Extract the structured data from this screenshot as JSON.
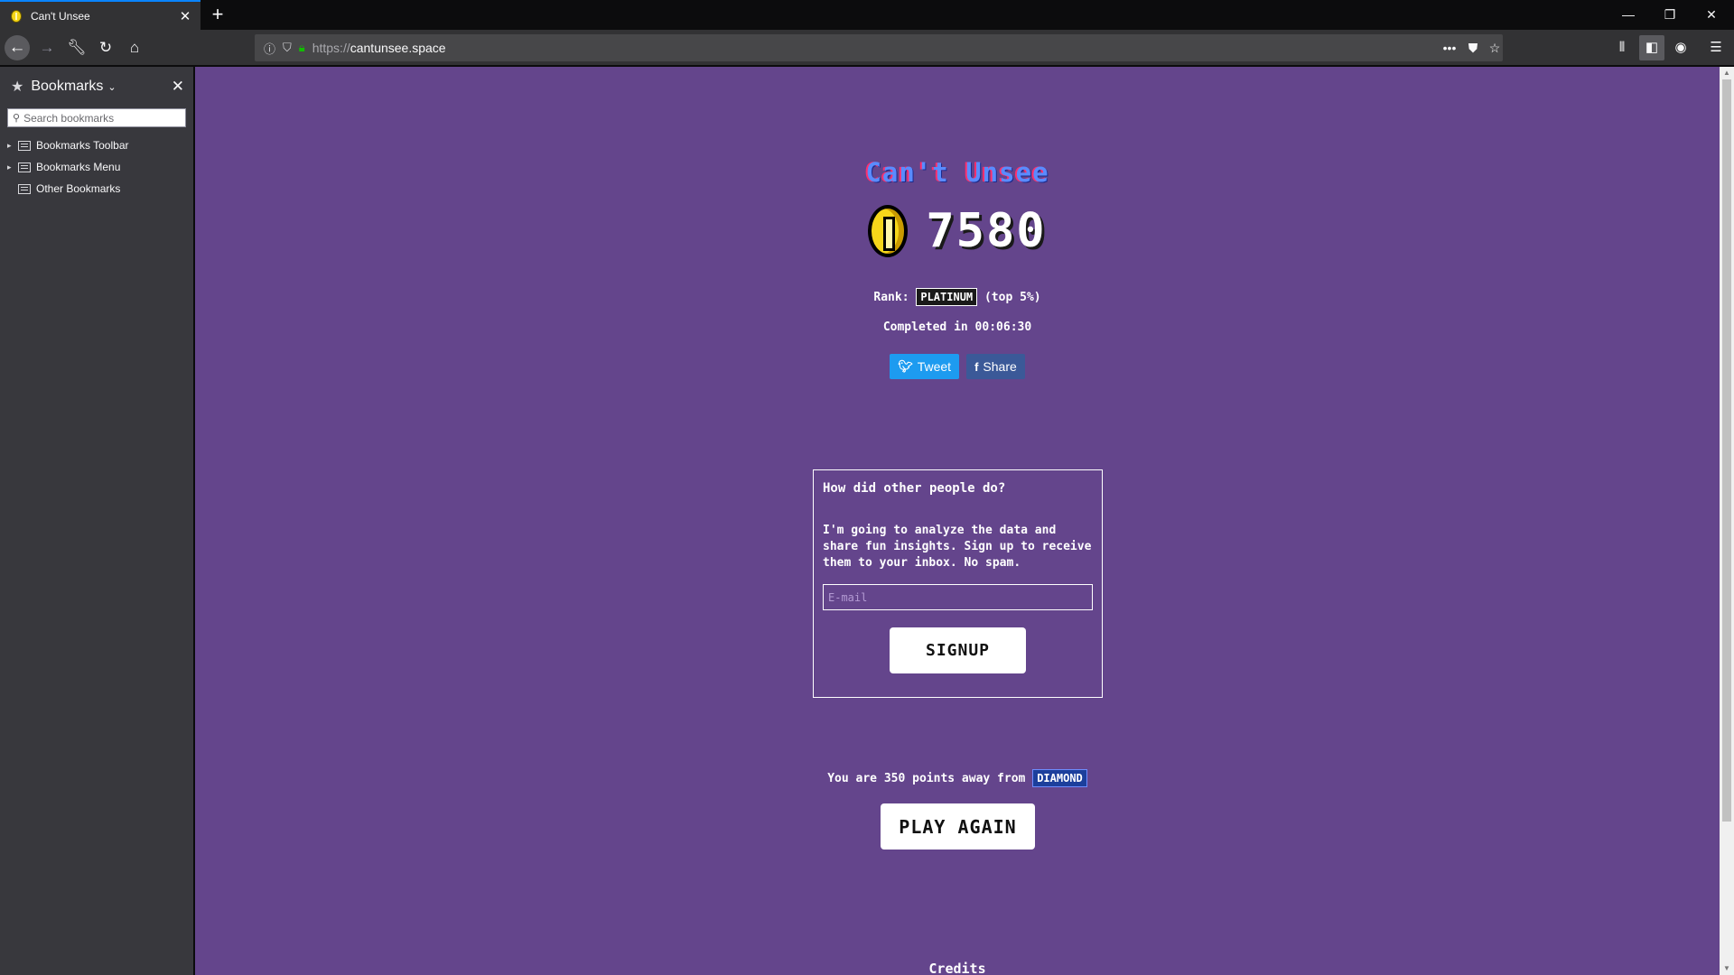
{
  "browser": {
    "tab_title": "Can't Unsee",
    "tab_close": "✕",
    "new_tab": "+",
    "url_scheme": "https://",
    "url_host": "cantunsee.space",
    "page_actions": "•••",
    "window": {
      "minimize": "—",
      "restore": "❐",
      "close": "✕"
    }
  },
  "sidebar": {
    "title": "Bookmarks",
    "close": "✕",
    "search_placeholder": "Search bookmarks",
    "items": [
      {
        "label": "Bookmarks Toolbar",
        "expandable": true
      },
      {
        "label": "Bookmarks Menu",
        "expandable": true
      },
      {
        "label": "Other Bookmarks",
        "expandable": false
      }
    ]
  },
  "game": {
    "title": "Can't Unsee",
    "score": "7580",
    "rank_prefix": "Rank:",
    "rank": "PLATINUM",
    "rank_suffix": "(top 5%)",
    "completed": "Completed in 00:06:30",
    "tweet_label": "Tweet",
    "share_label": "Share"
  },
  "signup": {
    "heading": "How did other people do?",
    "body": "I'm going to analyze the data and share fun insights. Sign up to receive them to your inbox. No spam.",
    "email_placeholder": "E-mail",
    "button": "SIGNUP"
  },
  "next": {
    "away_prefix": "You are 350 points away from",
    "next_rank": "DIAMOND",
    "play_again": "PLAY AGAIN"
  },
  "footer": {
    "credits": "Credits"
  },
  "colors": {
    "page_bg": "#64458c",
    "tweet": "#1d9bf0",
    "facebook": "#3b5998",
    "coin": "#f6d61a"
  }
}
